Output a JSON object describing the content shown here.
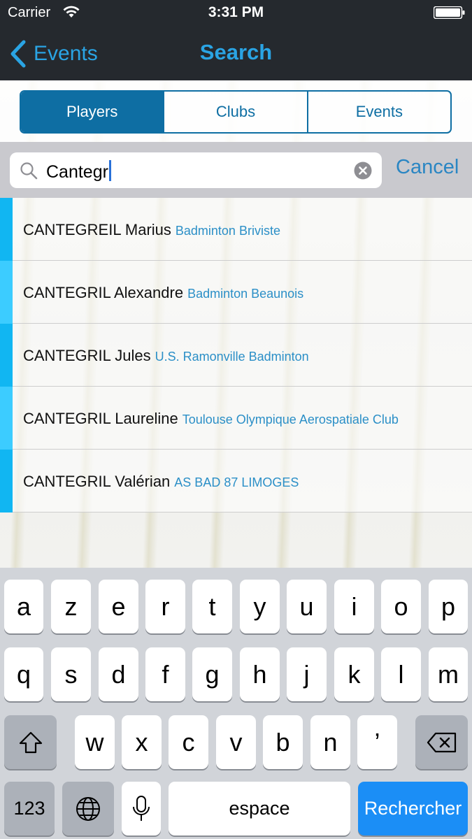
{
  "status_bar": {
    "carrier": "Carrier",
    "time": "3:31 PM"
  },
  "nav": {
    "back_label": "Events",
    "title": "Search"
  },
  "segments": [
    "Players",
    "Clubs",
    "Events"
  ],
  "search": {
    "value": "Cantegr",
    "cancel_label": "Cancel"
  },
  "results": [
    {
      "name": "CANTEGREIL Marius",
      "club": "Badminton Briviste"
    },
    {
      "name": "CANTEGRIL Alexandre",
      "club": "Badminton Beaunois"
    },
    {
      "name": "CANTEGRIL Jules",
      "club": "U.S. Ramonville Badminton"
    },
    {
      "name": "CANTEGRIL Laureline",
      "club": "Toulouse Olympique Aerospatiale Club"
    },
    {
      "name": "CANTEGRIL Valérian",
      "club": "AS BAD 87 LIMOGES"
    }
  ],
  "keyboard": {
    "row1": [
      "a",
      "z",
      "e",
      "r",
      "t",
      "y",
      "u",
      "i",
      "o",
      "p"
    ],
    "row2": [
      "q",
      "s",
      "d",
      "f",
      "g",
      "h",
      "j",
      "k",
      "l",
      "m"
    ],
    "row3": [
      "w",
      "x",
      "c",
      "v",
      "b",
      "n",
      "’"
    ],
    "numbers_label": "123",
    "space_label": "espace",
    "return_label": "Rechercher"
  },
  "colors": {
    "accent": "#2aa4e4",
    "segment": "#0e6ea3",
    "stripe": "#11b6f2",
    "club_text": "#2b8fc7",
    "return_key": "#1b8ef6"
  }
}
